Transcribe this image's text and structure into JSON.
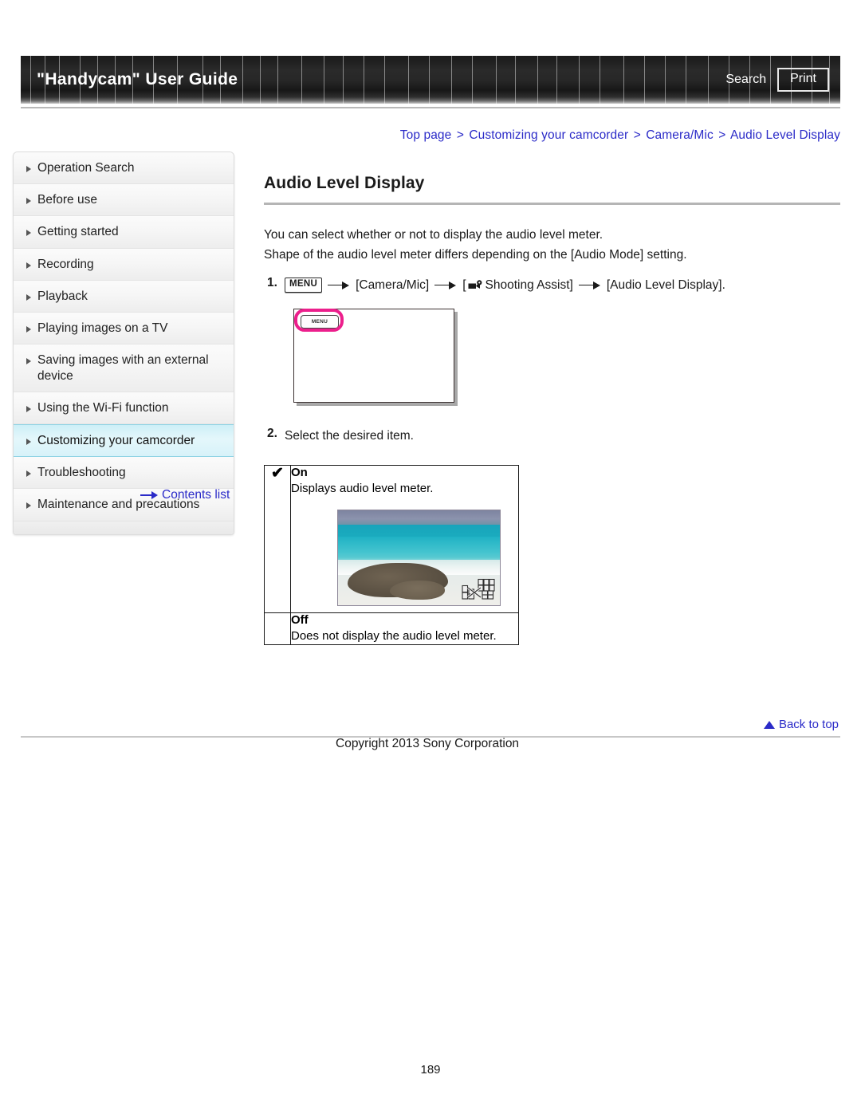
{
  "header": {
    "title": "\"Handycam\" User Guide",
    "search_label": "Search",
    "print_label": "Print"
  },
  "breadcrumb": {
    "items": [
      "Top page",
      "Customizing your camcorder",
      "Camera/Mic",
      "Audio Level Display"
    ],
    "separator": ">",
    "link_color": "#2b2bc8"
  },
  "sidebar": {
    "items": [
      {
        "label": "Operation Search",
        "active": false
      },
      {
        "label": "Before use",
        "active": false
      },
      {
        "label": "Getting started",
        "active": false
      },
      {
        "label": "Recording",
        "active": false
      },
      {
        "label": "Playback",
        "active": false
      },
      {
        "label": "Playing images on a TV",
        "active": false
      },
      {
        "label": "Saving images with an external device",
        "active": false
      },
      {
        "label": "Using the Wi-Fi function",
        "active": false
      },
      {
        "label": "Customizing your camcorder",
        "active": true
      },
      {
        "label": "Troubleshooting",
        "active": false
      },
      {
        "label": "Maintenance and precautions",
        "active": false
      }
    ],
    "contents_list_label": "Contents list",
    "active_highlight_color": "#cdeff7"
  },
  "main": {
    "title": "Audio Level Display",
    "paragraph_1": "You can select whether or not to display the audio level meter.",
    "paragraph_2": "Shape of the audio level meter differs depending on the [Audio Mode] setting.",
    "step1": {
      "number": "1.",
      "menu_chip": "MENU",
      "part_camera_mic": "[Camera/Mic]",
      "bracket_open": "[",
      "part_shooting_assist": "Shooting Assist]",
      "part_audio_level": "[Audio Level Display]."
    },
    "figure": {
      "menu_chip_label": "MENU",
      "highlight_color": "#ec1f8c"
    },
    "step2": {
      "number": "2.",
      "text": "Select the desired item."
    },
    "options_table": {
      "check_glyph": "✔",
      "rows": [
        {
          "checked": true,
          "title": "On",
          "description": "Displays audio level meter.",
          "has_photo": true
        },
        {
          "checked": false,
          "title": "Off",
          "description": "Does not display the audio level meter.",
          "has_photo": false
        }
      ]
    }
  },
  "footer": {
    "back_to_top_label": "Back to top",
    "copyright": "Copyright 2013 Sony Corporation",
    "page_number": "189"
  }
}
